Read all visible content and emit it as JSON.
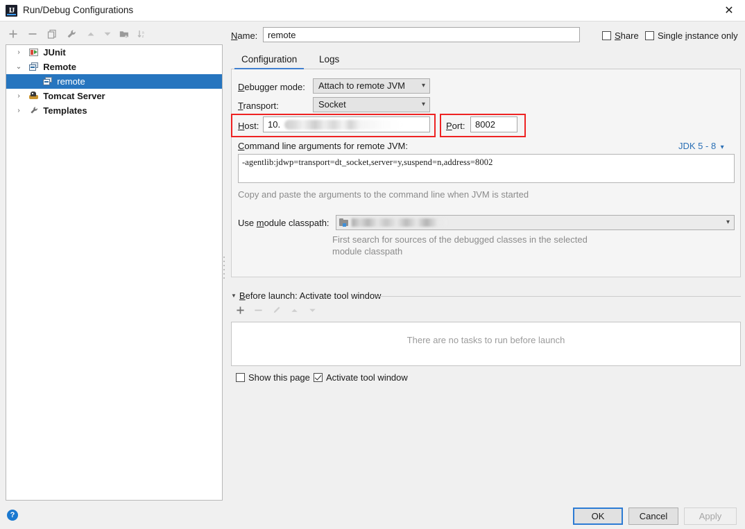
{
  "window": {
    "title": "Run/Debug Configurations",
    "app_icon": "intellij-idea-icon",
    "close_label": "✕"
  },
  "left_toolbar": {
    "buttons": [
      {
        "name": "add-configuration-button",
        "glyph": "+",
        "tooltip": "Add New Configuration"
      },
      {
        "name": "remove-configuration-button",
        "glyph": "−",
        "tooltip": "Remove Configuration"
      },
      {
        "name": "copy-configuration-button",
        "glyph": "copy-icon",
        "tooltip": "Copy Configuration"
      },
      {
        "name": "edit-defaults-button",
        "glyph": "wrench-icon",
        "tooltip": "Edit defaults"
      },
      {
        "name": "move-up-button",
        "glyph": "▲",
        "tooltip": "Move Up"
      },
      {
        "name": "move-down-button",
        "glyph": "▼",
        "tooltip": "Move Down"
      },
      {
        "name": "create-folder-button",
        "glyph": "folder-plus-icon",
        "tooltip": "Create New Folder"
      },
      {
        "name": "sort-configurations-button",
        "glyph": "sort-az-icon",
        "tooltip": "Sort Configurations"
      }
    ]
  },
  "tree": {
    "items": [
      {
        "label": "JUnit",
        "icon": "junit-icon",
        "expander": "›",
        "level": 0,
        "bold": true,
        "selected": false
      },
      {
        "label": "Remote",
        "icon": "remote-icon",
        "expander": "⌄",
        "level": 0,
        "bold": true,
        "selected": false
      },
      {
        "label": "remote",
        "icon": "remote-icon",
        "expander": "",
        "level": 1,
        "bold": false,
        "selected": true
      },
      {
        "label": "Tomcat Server",
        "icon": "tomcat-icon",
        "expander": "›",
        "level": 0,
        "bold": true,
        "selected": false
      },
      {
        "label": "Templates",
        "icon": "wrench-icon",
        "expander": "›",
        "level": 0,
        "bold": true,
        "selected": false
      }
    ],
    "selected_color": "#2675bf"
  },
  "header": {
    "name_label": "Name:",
    "name_label_mnemonic": "N",
    "name_value": "remote",
    "share_label": "Share",
    "share_checked": false,
    "single_instance_label": "Single instance only",
    "single_instance_checked": false
  },
  "tabs": {
    "items": [
      {
        "label": "Configuration",
        "active": true
      },
      {
        "label": "Logs",
        "active": false
      }
    ],
    "active_underline_color": "#3f7fcf"
  },
  "configuration": {
    "debugger_mode_label": "Debugger mode:",
    "debugger_mode_value": "Attach to remote JVM",
    "transport_label": "Transport:",
    "transport_value": "Socket",
    "host_label": "Host:",
    "host_value": "10.",
    "host_redacted": true,
    "port_label": "Port:",
    "port_value": "8002",
    "cmdline_label": "Command line arguments for remote JVM:",
    "jdk_selector": "JDK 5 - 8",
    "cmdline_value": "-agentlib:jdwp=transport=dt_socket,server=y,suspend=n,address=8002",
    "cmdline_hint": "Copy and paste the arguments to the command line when JVM is started",
    "module_classpath_label": "Use module classpath:",
    "module_classpath_value": "",
    "module_classpath_redacted": true,
    "module_hint_line1": "First search for sources of the debugged classes in the selected",
    "module_hint_line2": "module classpath",
    "highlight_color": "#ee2222"
  },
  "before_launch": {
    "title": "Before launch: Activate tool window",
    "toolbar": [
      {
        "name": "add-task-button",
        "glyph": "+",
        "enabled": true
      },
      {
        "name": "remove-task-button",
        "glyph": "−",
        "enabled": false
      },
      {
        "name": "edit-task-button",
        "glyph": "pencil-icon",
        "enabled": false
      },
      {
        "name": "task-move-up-button",
        "glyph": "▲",
        "enabled": false
      },
      {
        "name": "task-move-down-button",
        "glyph": "▼",
        "enabled": false
      }
    ],
    "empty_text": "There are no tasks to run before launch",
    "show_page_label": "Show this page",
    "show_page_checked": false,
    "activate_tool_window_label": "Activate tool window",
    "activate_tool_window_checked": true
  },
  "footer": {
    "help_glyph": "?",
    "ok_label": "OK",
    "cancel_label": "Cancel",
    "apply_label": "Apply",
    "apply_enabled": false
  }
}
